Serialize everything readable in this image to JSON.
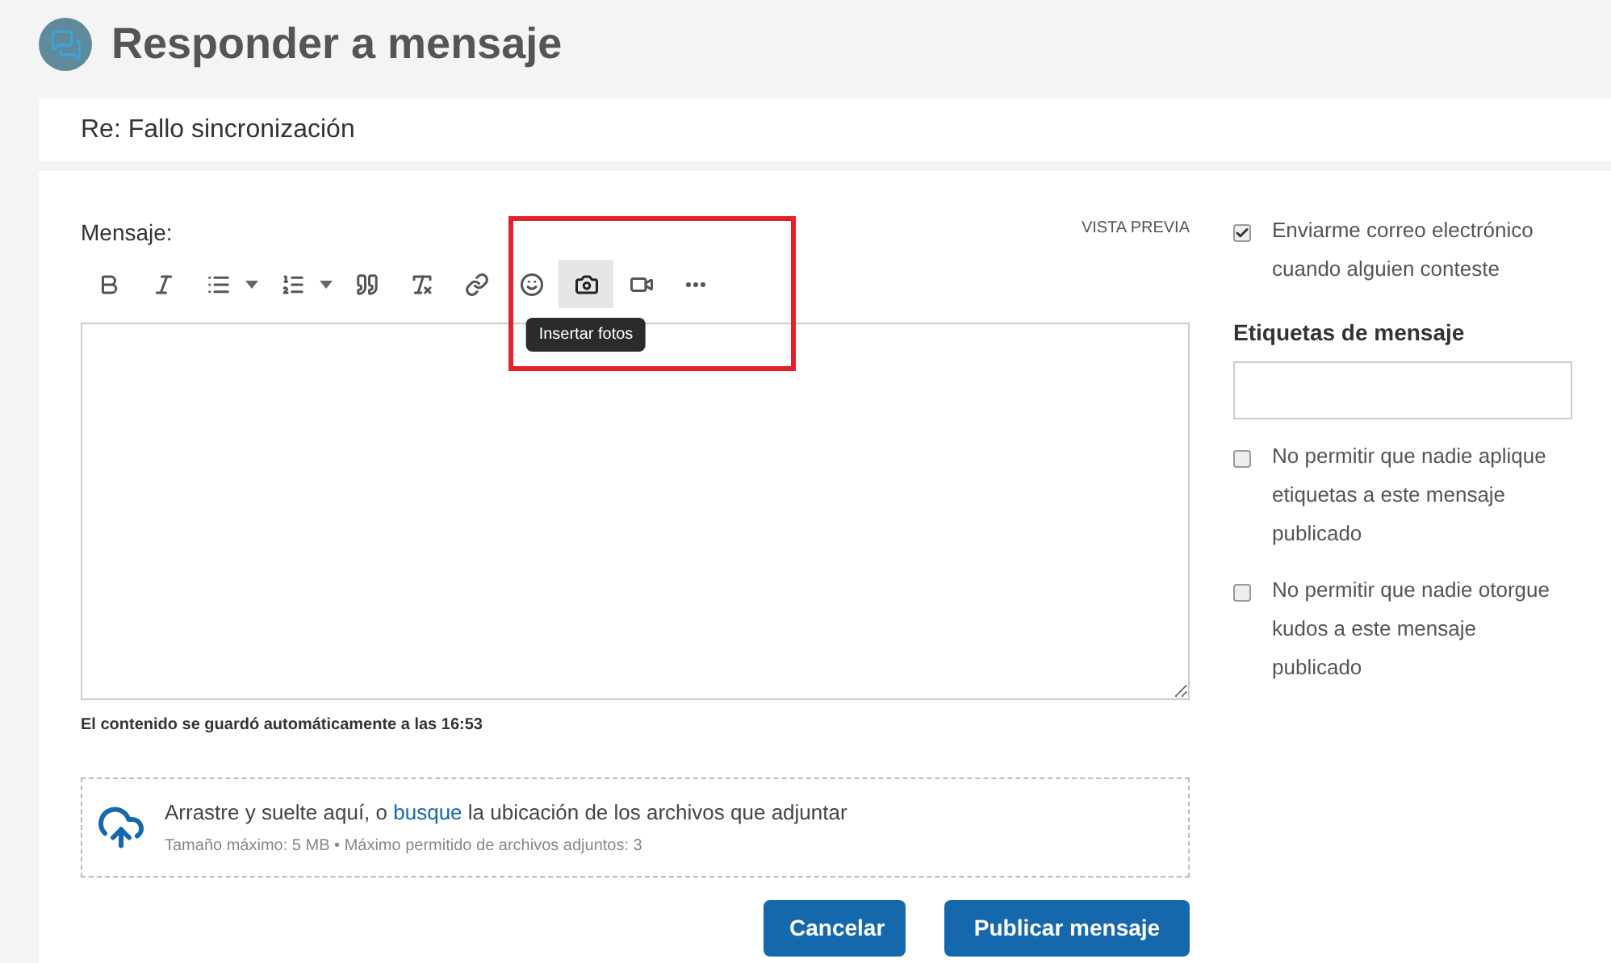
{
  "header": {
    "title": "Responder a mensaje"
  },
  "subject": "Re: Fallo sincronización",
  "editor": {
    "label": "Mensaje:",
    "preview": "VISTA PREVIA",
    "toolbar": [
      {
        "kind": "bold",
        "active": false,
        "menu": false
      },
      {
        "kind": "italic",
        "active": false,
        "menu": false
      },
      {
        "kind": "bullets",
        "active": false,
        "menu": true
      },
      {
        "kind": "numbered",
        "active": false,
        "menu": true
      },
      {
        "kind": "quote",
        "active": false,
        "menu": false
      },
      {
        "kind": "clear",
        "active": false,
        "menu": false
      },
      {
        "kind": "link",
        "active": false,
        "menu": false
      },
      {
        "kind": "emoji",
        "active": false,
        "menu": false
      },
      {
        "kind": "photo",
        "active": true,
        "menu": false,
        "tooltip": "Insertar fotos"
      },
      {
        "kind": "video",
        "active": false,
        "menu": false
      },
      {
        "kind": "more",
        "active": false,
        "menu": false
      }
    ],
    "autosave": "El contenido se guardó automáticamente a las 16:53"
  },
  "upload": {
    "before": "Arrastre y suelte aquí, o",
    "link": "busque",
    "after": "la ubicación de los archivos que adjuntar",
    "limits": "Tamaño máximo: 5 MB • Máximo permitido de archivos adjuntos: 3"
  },
  "buttons": [
    {
      "label": "Cancelar"
    },
    {
      "label": "Publicar mensaje"
    }
  ],
  "options": [
    {
      "kind": "checkbox",
      "label": "Enviarme correo electrónico cuando alguien conteste",
      "checked": true
    },
    {
      "kind": "tags",
      "label": "Etiquetas de mensaje"
    },
    {
      "kind": "checkbox",
      "label": "No permitir que nadie aplique etiquetas a este mensaje publicado",
      "checked": false
    },
    {
      "kind": "checkbox",
      "label": "No permitir que nadie otorgue kudos a este mensaje publicado",
      "checked": false
    }
  ]
}
